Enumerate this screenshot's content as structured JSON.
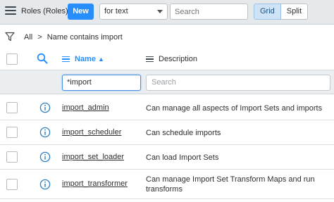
{
  "header": {
    "title": "Roles (Roles)",
    "new_label": "New",
    "search_field_selected": "for text",
    "search_placeholder": "Search",
    "view_grid": "Grid",
    "view_split": "Split"
  },
  "breadcrumb": {
    "all": "All",
    "separator": ">",
    "filter": "Name contains import"
  },
  "columns": {
    "name": "Name",
    "name_sort": "▲",
    "description": "Description"
  },
  "filters": {
    "name_value": "*import",
    "description_placeholder": "Search"
  },
  "rows": [
    {
      "name": "import_admin",
      "description": "Can manage all aspects of Import Sets and imports"
    },
    {
      "name": "import_scheduler",
      "description": "Can schedule imports"
    },
    {
      "name": "import_set_loader",
      "description": "Can load Import Sets"
    },
    {
      "name": "import_transformer",
      "description": "Can manage Import Set Transform Maps and run transforms"
    }
  ],
  "colors": {
    "accent": "#278efc",
    "header_bg": "#e6e9eb",
    "info_icon": "#2d7fc1"
  }
}
